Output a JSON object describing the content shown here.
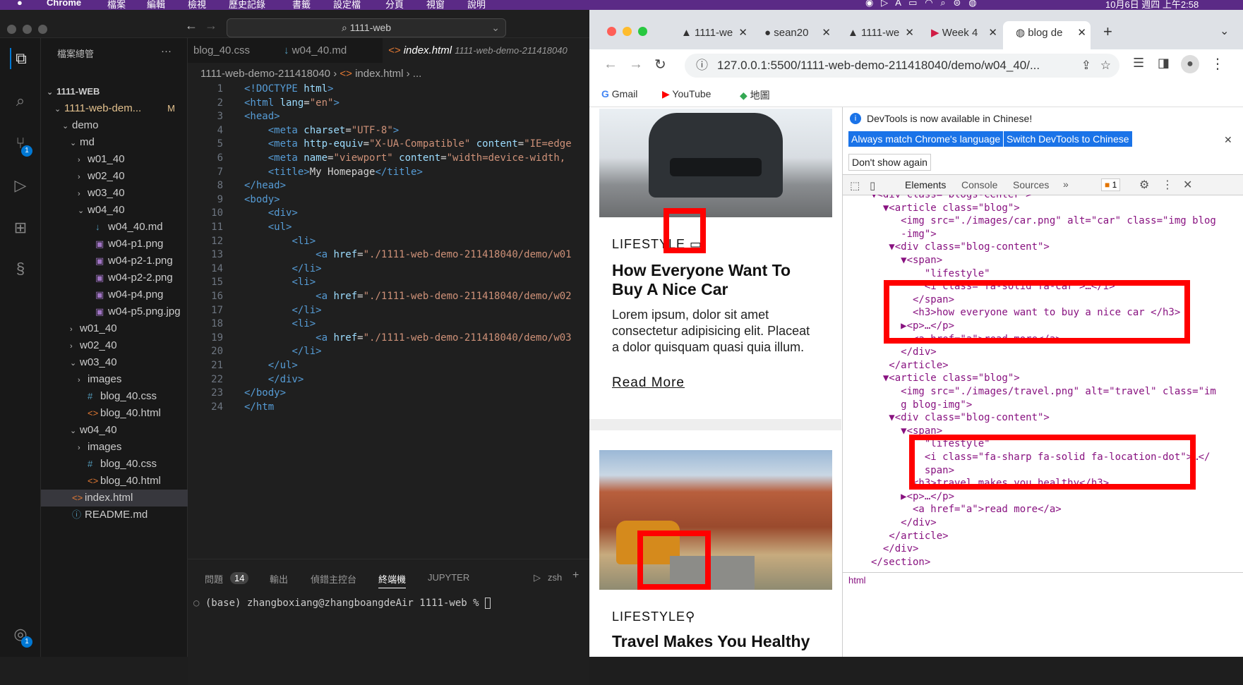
{
  "macbar": {
    "app": "Chrome",
    "menus": [
      "檔案",
      "編輯",
      "檢視",
      "歷史記錄",
      "書籤",
      "設定檔",
      "分頁",
      "視窗",
      "說明"
    ],
    "clock": "10月6日 週四 上午2:58"
  },
  "vscode": {
    "search": "1111-web",
    "explorer_title": "檔案總管",
    "explorer_dots": "···",
    "source_badge": "1",
    "account_badge": "1",
    "tree": [
      {
        "label": "1111-WEB",
        "indent": 0,
        "chev": "⌄",
        "icon": "",
        "bold": true
      },
      {
        "label": "1111-web-dem...",
        "indent": 1,
        "chev": "⌄",
        "icon": "",
        "modified": "M",
        "color": "#e2c08d"
      },
      {
        "label": "demo",
        "indent": 2,
        "chev": "⌄",
        "icon": ""
      },
      {
        "label": "md",
        "indent": 3,
        "chev": "⌄",
        "icon": ""
      },
      {
        "label": "w01_40",
        "indent": 4,
        "chev": "›",
        "icon": ""
      },
      {
        "label": "w02_40",
        "indent": 4,
        "chev": "›",
        "icon": ""
      },
      {
        "label": "w03_40",
        "indent": 4,
        "chev": "›",
        "icon": ""
      },
      {
        "label": "w04_40",
        "indent": 4,
        "chev": "⌄",
        "icon": ""
      },
      {
        "label": "w04_40.md",
        "indent": 5,
        "chev": "",
        "icon": "↓",
        "iconcolor": "#519aba"
      },
      {
        "label": "w04-p1.png",
        "indent": 5,
        "chev": "",
        "icon": "▣",
        "iconcolor": "#a074c4"
      },
      {
        "label": "w04-p2-1.png",
        "indent": 5,
        "chev": "",
        "icon": "▣",
        "iconcolor": "#a074c4"
      },
      {
        "label": "w04-p2-2.png",
        "indent": 5,
        "chev": "",
        "icon": "▣",
        "iconcolor": "#a074c4"
      },
      {
        "label": "w04-p4.png",
        "indent": 5,
        "chev": "",
        "icon": "▣",
        "iconcolor": "#a074c4"
      },
      {
        "label": "w04-p5.png.jpg",
        "indent": 5,
        "chev": "",
        "icon": "▣",
        "iconcolor": "#a074c4"
      },
      {
        "label": "w01_40",
        "indent": 3,
        "chev": "›",
        "icon": ""
      },
      {
        "label": "w02_40",
        "indent": 3,
        "chev": "›",
        "icon": ""
      },
      {
        "label": "w03_40",
        "indent": 3,
        "chev": "⌄",
        "icon": ""
      },
      {
        "label": "images",
        "indent": 4,
        "chev": "›",
        "icon": ""
      },
      {
        "label": "blog_40.css",
        "indent": 4,
        "chev": "",
        "icon": "#",
        "iconcolor": "#519aba"
      },
      {
        "label": "blog_40.html",
        "indent": 4,
        "chev": "",
        "icon": "<>",
        "iconcolor": "#e37933"
      },
      {
        "label": "w04_40",
        "indent": 3,
        "chev": "⌄",
        "icon": ""
      },
      {
        "label": "images",
        "indent": 4,
        "chev": "›",
        "icon": ""
      },
      {
        "label": "blog_40.css",
        "indent": 4,
        "chev": "",
        "icon": "#",
        "iconcolor": "#519aba"
      },
      {
        "label": "blog_40.html",
        "indent": 4,
        "chev": "",
        "icon": "<>",
        "iconcolor": "#e37933"
      },
      {
        "label": "index.html",
        "indent": 2,
        "chev": "",
        "icon": "<>",
        "iconcolor": "#e37933",
        "selected": true
      },
      {
        "label": "README.md",
        "indent": 2,
        "chev": "",
        "icon": "ⓘ",
        "iconcolor": "#519aba"
      }
    ],
    "tabs": [
      "blog_40.css",
      "w04_40.md",
      "index.html",
      "1111-web-demo-211418040"
    ],
    "breadcrumb": [
      "1111-web-demo-211418040",
      "index.html",
      "..."
    ],
    "code": [
      [
        [
          "tg",
          "<!DOCTYPE "
        ],
        [
          "at",
          "html"
        ],
        [
          "tg",
          ">"
        ]
      ],
      [
        [
          "tg",
          "<html "
        ],
        [
          "at",
          "lang"
        ],
        [
          "tx",
          "="
        ],
        [
          "st",
          "\"en\""
        ],
        [
          "tg",
          ">"
        ]
      ],
      [
        [
          "tg",
          "<head>"
        ]
      ],
      [
        [
          "tx",
          "    "
        ],
        [
          "tg",
          "<meta "
        ],
        [
          "at",
          "charset"
        ],
        [
          "tx",
          "="
        ],
        [
          "st",
          "\"UTF-8\""
        ],
        [
          "tg",
          ">"
        ]
      ],
      [
        [
          "tx",
          "    "
        ],
        [
          "tg",
          "<meta "
        ],
        [
          "at",
          "http-equiv"
        ],
        [
          "tx",
          "="
        ],
        [
          "st",
          "\"X-UA-Compatible\""
        ],
        [
          "at",
          " content"
        ],
        [
          "tx",
          "="
        ],
        [
          "st",
          "\"IE=edge"
        ]
      ],
      [
        [
          "tx",
          "    "
        ],
        [
          "tg",
          "<meta "
        ],
        [
          "at",
          "name"
        ],
        [
          "tx",
          "="
        ],
        [
          "st",
          "\"viewport\""
        ],
        [
          "at",
          " content"
        ],
        [
          "tx",
          "="
        ],
        [
          "st",
          "\"width=device-width,"
        ]
      ],
      [
        [
          "tx",
          "    "
        ],
        [
          "tg",
          "<title>"
        ],
        [
          "tx",
          "My Homepage"
        ],
        [
          "tg",
          "</title>"
        ]
      ],
      [
        [
          "tg",
          "</head>"
        ]
      ],
      [
        [
          "tg",
          "<body>"
        ]
      ],
      [
        [
          "tx",
          "    "
        ],
        [
          "tg",
          "<div>"
        ]
      ],
      [
        [
          "tx",
          "    "
        ],
        [
          "tg",
          "<ul>"
        ]
      ],
      [
        [
          "tx",
          "        "
        ],
        [
          "tg",
          "<li>"
        ]
      ],
      [
        [
          "tx",
          "            "
        ],
        [
          "tg",
          "<a "
        ],
        [
          "at",
          "href"
        ],
        [
          "tx",
          "="
        ],
        [
          "st",
          "\"./1111-web-demo-211418040/demo/w01"
        ]
      ],
      [
        [
          "tx",
          "        "
        ],
        [
          "tg",
          "</li>"
        ]
      ],
      [
        [
          "tx",
          "        "
        ],
        [
          "tg",
          "<li>"
        ]
      ],
      [
        [
          "tx",
          "            "
        ],
        [
          "tg",
          "<a "
        ],
        [
          "at",
          "href"
        ],
        [
          "tx",
          "="
        ],
        [
          "st",
          "\"./1111-web-demo-211418040/demo/w02"
        ]
      ],
      [
        [
          "tx",
          "        "
        ],
        [
          "tg",
          "</li>"
        ]
      ],
      [
        [
          "tx",
          "        "
        ],
        [
          "tg",
          "<li>"
        ]
      ],
      [
        [
          "tx",
          "            "
        ],
        [
          "tg",
          "<a "
        ],
        [
          "at",
          "href"
        ],
        [
          "tx",
          "="
        ],
        [
          "st",
          "\"./1111-web-demo-211418040/demo/w03"
        ]
      ],
      [
        [
          "tx",
          "        "
        ],
        [
          "tg",
          "</li>"
        ]
      ],
      [
        [
          "tx",
          "    "
        ],
        [
          "tg",
          "</ul>"
        ]
      ],
      [
        [
          "tx",
          "    "
        ],
        [
          "tg",
          "</div>"
        ]
      ],
      [
        [
          "tg",
          "</body>"
        ]
      ],
      [
        [
          "tg",
          "</htm"
        ]
      ]
    ],
    "panel_tabs": [
      "問題",
      "14",
      "輸出",
      "偵錯主控台",
      "終端機",
      "JUPYTER"
    ],
    "shell": "zsh",
    "terminal_line": "(base) zhangboxiang@zhangboangdeAir 1111-web % "
  },
  "chrome": {
    "tabs": [
      "1111-we",
      "sean20",
      "1111-we",
      "Week 4",
      "blog de"
    ],
    "url": "127.0.0.1:5500/1111-web-demo-211418040/demo/w04_40/...",
    "bookmarks": [
      "Gmail",
      "YouTube",
      "地圖"
    ],
    "card1": {
      "category": "LIFESTYLE",
      "title": "How Everyone Want To Buy A Nice Car",
      "body": "Lorem ipsum, dolor sit amet consectetur adipisicing elit. Placeat a dolor quisquam quasi quia illum.",
      "link": "Read More"
    },
    "card2": {
      "category": "LIFESTYLE",
      "title": "Travel Makes You Healthy"
    }
  },
  "devtools": {
    "notice": "DevTools is now available in Chinese!",
    "btn_match": "Always match Chrome's language",
    "btn_switch": "Switch DevTools to Chinese",
    "btn_dont": "Don't show again",
    "tabs": [
      "Elements",
      "Console",
      "Sources"
    ],
    "issues": "1",
    "footer": "html",
    "lines": [
      "▼<div class=\"blogs-center\">",
      "  ▼<article class=\"blog\">",
      "     <img src=\"./images/car.png\" alt=\"car\" class=\"img blog",
      "     -img\">",
      "   ▼<div class=\"blog-content\">",
      "     ▼<span>",
      "         \"lifestyle\"",
      "         <i class=\"fa-solid fa-car\">…</i>",
      "       </span>",
      "       <h3>how everyone want to buy a nice car </h3>",
      "     ▶<p>…</p>",
      "       <a href=\"a\">read more</a>",
      "     </div>",
      "   </article>",
      "  ▼<article class=\"blog\">",
      "     <img src=\"./images/travel.png\" alt=\"travel\" class=\"im",
      "     g blog-img\">",
      "   ▼<div class=\"blog-content\">",
      "     ▼<span>",
      "         \"lifestyle\"",
      "         <i class=\"fa-sharp fa-solid fa-location-dot\">…</",
      "         span>",
      "       <h3>travel makes you healthy</h3>",
      "     ▶<p>…</p>",
      "       <a href=\"a\">read more</a>",
      "     </div>",
      "   </article>",
      "  </div>",
      "</section>"
    ]
  }
}
